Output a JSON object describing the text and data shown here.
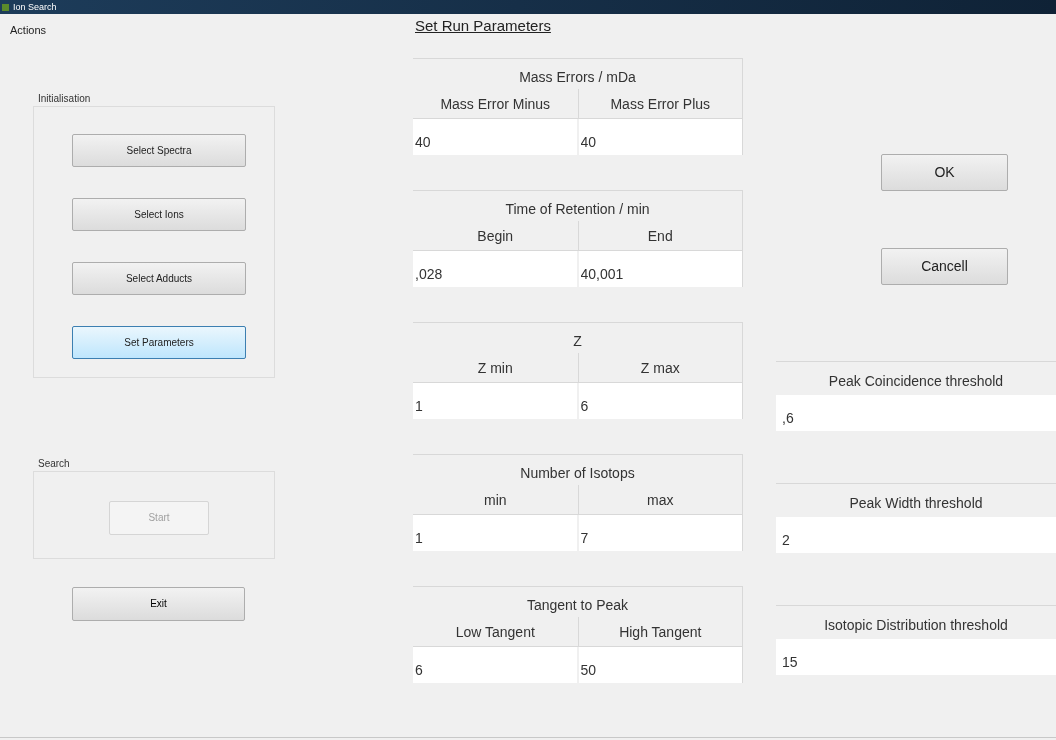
{
  "window": {
    "title": "Ion Search"
  },
  "menu": [
    "Actions"
  ],
  "groups": [
    {
      "label": "Initialisation",
      "buttons": [
        {
          "label": "Select Spectra",
          "selected": false,
          "disabled": false
        },
        {
          "label": "Select Ions",
          "selected": false,
          "disabled": false
        },
        {
          "label": "Select Adducts",
          "selected": false,
          "disabled": false
        },
        {
          "label": "Set Parameters",
          "selected": true,
          "disabled": false
        }
      ]
    },
    {
      "label": "Search",
      "buttons": [
        {
          "label": "Start",
          "selected": false,
          "disabled": true
        }
      ]
    }
  ],
  "exit_button": "Exit",
  "heading": "Set Run Parameters",
  "parameter_groups": [
    {
      "title": "Mass Errors / mDa",
      "columns": [
        {
          "header": "Mass Error Minus",
          "value": "40"
        },
        {
          "header": "Mass Error Plus",
          "value": "40"
        }
      ]
    },
    {
      "title": "Time of Retention / min",
      "columns": [
        {
          "header": "Begin",
          "value": ",028"
        },
        {
          "header": "End",
          "value": "40,001"
        }
      ]
    },
    {
      "title": "Z",
      "columns": [
        {
          "header": "Z min",
          "value": "1"
        },
        {
          "header": "Z max",
          "value": "6"
        }
      ]
    },
    {
      "title": "Number of Isotops",
      "columns": [
        {
          "header": "min",
          "value": "1"
        },
        {
          "header": "max",
          "value": "7"
        }
      ]
    },
    {
      "title": "Tangent to Peak",
      "columns": [
        {
          "header": "Low Tangent",
          "value": "6"
        },
        {
          "header": "High Tangent",
          "value": "50"
        }
      ]
    }
  ],
  "dialog_buttons": [
    "OK",
    "Cancell"
  ],
  "thresholds": [
    {
      "label": "Peak Coincidence threshold",
      "value": ",6"
    },
    {
      "label": "Peak Width threshold",
      "value": "2"
    },
    {
      "label": "Isotopic Distribution threshold",
      "value": "15"
    }
  ]
}
